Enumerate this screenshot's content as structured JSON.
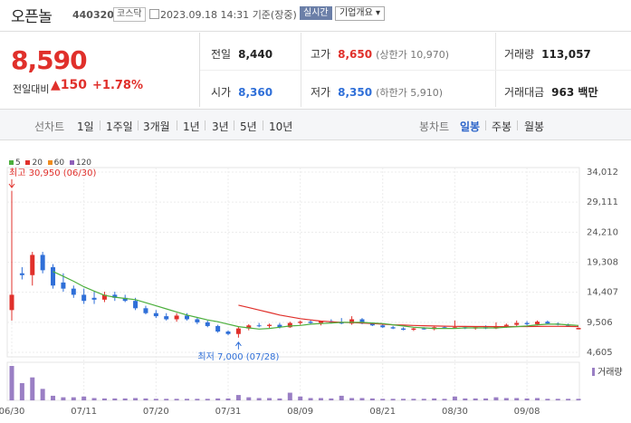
{
  "header": {
    "stock_name": "오픈놀",
    "stock_code": "440320",
    "market": "코스닥",
    "datetime": "2023.09.18 14:31",
    "basis": "기준(장중)",
    "realtime_button": "실시간",
    "company_button": "기업개요"
  },
  "price": {
    "current": "8,590",
    "change_label": "전일대비",
    "change_value": "150",
    "change_percent": "+1.78%"
  },
  "stats": {
    "prev_close": {
      "label": "전일",
      "value": "8,440"
    },
    "high": {
      "label": "고가",
      "value": "8,650",
      "sub": "(상한가 10,970)"
    },
    "volume": {
      "label": "거래량",
      "value": "113,057"
    },
    "open": {
      "label": "시가",
      "value": "8,360"
    },
    "low": {
      "label": "저가",
      "value": "8,350",
      "sub": "(하한가 5,910)"
    },
    "amount": {
      "label": "거래대금",
      "value": "963 백만"
    }
  },
  "tabs": {
    "line_label": "선차트",
    "line": [
      "1일",
      "1주일",
      "3개월",
      "1년",
      "3년",
      "5년",
      "10년"
    ],
    "candle_label": "봉차트",
    "candle": [
      "일봉",
      "주봉",
      "월봉"
    ],
    "active_candle": "일봉"
  },
  "legend": [
    {
      "label": "5",
      "color": "#4caf3d"
    },
    {
      "label": "20",
      "color": "#e0302b"
    },
    {
      "label": "60",
      "color": "#f08c1e"
    },
    {
      "label": "120",
      "color": "#8e5fb8"
    }
  ],
  "chart_data": {
    "type": "candlestick",
    "y_ticks": [
      "34,012",
      "29,111",
      "24,210",
      "19,308",
      "14,407",
      "9,506",
      "4,605"
    ],
    "y_tick_values": [
      34012,
      29111,
      24210,
      19308,
      14407,
      9506,
      4605
    ],
    "x_ticks": [
      "06/30",
      "07/11",
      "07/20",
      "07/31",
      "08/09",
      "08/21",
      "08/30",
      "09/08"
    ],
    "x_tick_index": [
      0,
      7,
      14,
      21,
      28,
      36,
      43,
      50
    ],
    "max_annotation": "최고 30,950 (06/30)",
    "min_annotation": "최저 7,000 (07/28)",
    "volume_label": "거래량",
    "colors": {
      "up": "#e0302b",
      "down": "#2f6fd8",
      "ma5": "#4caf3d",
      "ma20": "#e0302b"
    },
    "candles": [
      [
        11500,
        30950,
        9800,
        14000
      ],
      [
        17500,
        18500,
        16500,
        17200
      ],
      [
        17200,
        21000,
        15500,
        20500
      ],
      [
        20500,
        21000,
        17500,
        18000
      ],
      [
        18500,
        19000,
        15000,
        15500
      ],
      [
        16000,
        17500,
        14500,
        15000
      ],
      [
        15000,
        15500,
        13500,
        14000
      ],
      [
        14000,
        15000,
        12500,
        13000
      ],
      [
        13500,
        14500,
        12500,
        13200
      ],
      [
        13200,
        14500,
        12800,
        14000
      ],
      [
        14000,
        14500,
        13000,
        13500
      ],
      [
        13500,
        14000,
        12800,
        13000
      ],
      [
        13000,
        13500,
        11500,
        11800
      ],
      [
        11800,
        12200,
        10800,
        11000
      ],
      [
        11000,
        11500,
        10200,
        10500
      ],
      [
        10500,
        11000,
        9800,
        10000
      ],
      [
        10000,
        11000,
        9600,
        10600
      ],
      [
        10600,
        11000,
        9800,
        10000
      ],
      [
        10000,
        10300,
        9200,
        9500
      ],
      [
        9500,
        9800,
        8700,
        8900
      ],
      [
        8900,
        9100,
        7800,
        8000
      ],
      [
        8000,
        8200,
        7400,
        7600
      ],
      [
        7600,
        8800,
        7000,
        8500
      ],
      [
        8500,
        9200,
        8200,
        9000
      ],
      [
        9000,
        9400,
        8700,
        8900
      ],
      [
        8900,
        9300,
        8600,
        9100
      ],
      [
        9100,
        9400,
        8500,
        8700
      ],
      [
        8700,
        9600,
        8600,
        9400
      ],
      [
        9400,
        9800,
        9100,
        9600
      ],
      [
        9600,
        9900,
        9200,
        9400
      ],
      [
        9400,
        9700,
        9000,
        9700
      ],
      [
        9700,
        10000,
        9300,
        9500
      ],
      [
        9500,
        10200,
        9200,
        9300
      ],
      [
        9300,
        10500,
        9100,
        10000
      ],
      [
        10000,
        10200,
        9200,
        9300
      ],
      [
        9300,
        9500,
        8900,
        9000
      ],
      [
        9000,
        9200,
        8600,
        8700
      ],
      [
        8700,
        8900,
        8400,
        8500
      ],
      [
        8500,
        8700,
        8200,
        8300
      ],
      [
        8300,
        8600,
        8100,
        8500
      ],
      [
        8500,
        8700,
        8300,
        8400
      ],
      [
        8400,
        8800,
        8200,
        8700
      ],
      [
        8700,
        8900,
        8500,
        8600
      ],
      [
        8600,
        9800,
        8500,
        8700
      ],
      [
        8700,
        8900,
        8400,
        8500
      ],
      [
        8500,
        8800,
        8300,
        8700
      ],
      [
        8700,
        9000,
        8400,
        8500
      ],
      [
        8500,
        9500,
        8400,
        8900
      ],
      [
        8900,
        9300,
        8600,
        9100
      ],
      [
        9100,
        9800,
        8800,
        9400
      ],
      [
        9400,
        9700,
        9000,
        9200
      ],
      [
        9200,
        9800,
        9000,
        9600
      ],
      [
        9600,
        9800,
        9200,
        9300
      ],
      [
        9300,
        9500,
        9000,
        9100
      ],
      [
        9100,
        9300,
        8800,
        9000
      ],
      [
        8360,
        8650,
        8350,
        8590
      ]
    ],
    "ma5": [
      null,
      null,
      null,
      null,
      17800,
      17000,
      16200,
      15300,
      14600,
      13900,
      13600,
      13400,
      13200,
      12700,
      12200,
      11700,
      11200,
      10700,
      10300,
      9900,
      9600,
      9200,
      8800,
      8600,
      8400,
      8500,
      8700,
      8900,
      9000,
      9200,
      9300,
      9400,
      9500,
      9500,
      9500,
      9400,
      9300,
      9100,
      8900,
      8700,
      8600,
      8500,
      8500,
      8500,
      8600,
      8600,
      8600,
      8600,
      8700,
      8800,
      8900,
      9100,
      9200,
      9200,
      9100,
      9000
    ],
    "ma20": [
      null,
      null,
      null,
      null,
      null,
      null,
      null,
      null,
      null,
      null,
      null,
      null,
      null,
      null,
      null,
      null,
      null,
      null,
      null,
      null,
      null,
      null,
      12300,
      11900,
      11500,
      11100,
      10700,
      10400,
      10100,
      9900,
      9700,
      9600,
      9500,
      9450,
      9400,
      9300,
      9200,
      9100,
      9050,
      9000,
      8950,
      8900,
      8870,
      8850,
      8830,
      8820,
      8810,
      8800,
      8800,
      8810,
      8820,
      8830,
      8840,
      8840,
      8830,
      8820
    ],
    "volume": [
      90,
      45,
      60,
      30,
      12,
      8,
      8,
      10,
      6,
      5,
      5,
      5,
      6,
      5,
      4,
      4,
      4,
      4,
      4,
      4,
      5,
      5,
      14,
      8,
      6,
      6,
      5,
      20,
      10,
      6,
      6,
      5,
      12,
      6,
      6,
      5,
      4,
      4,
      4,
      4,
      4,
      5,
      4,
      10,
      5,
      5,
      5,
      8,
      6,
      6,
      5,
      6,
      4,
      4,
      4,
      4
    ]
  }
}
